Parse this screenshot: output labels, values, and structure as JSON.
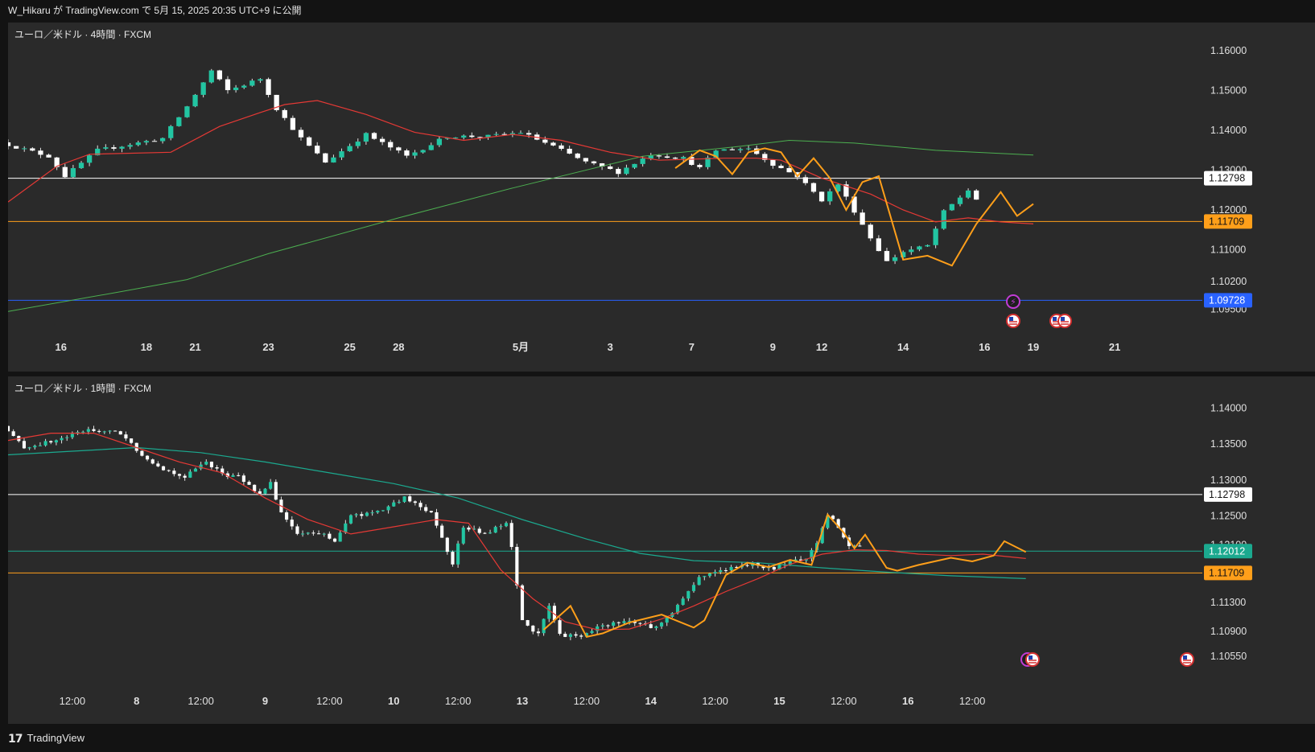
{
  "header": {
    "published": "W_Hikaru が TradingView.com で 5月 15, 2025 20:35 UTC+9 に公開"
  },
  "footer": {
    "brand": "TradingView",
    "logo_icon": "tradingview-logo-icon"
  },
  "colors": {
    "bg": "#2a2a2a",
    "up": "#22c5a2",
    "down": "#ffffff",
    "wick": "#e0e0e0",
    "ma_red": "#e53935",
    "ma_green": "#4caf50",
    "ma_teal": "#1ba98f",
    "zigzag": "#ff9f1a",
    "orange_line": "#ff9f1a",
    "white_line": "#ffffff",
    "blue_line": "#2962ff"
  },
  "chart_data": [
    {
      "type": "candlestick",
      "title": "ユーロ／米ドル · 4時間 · FXCM",
      "symbol": "EURUSD",
      "timeframe": "4時間",
      "source": "FXCM",
      "ylim": [
        1.0915,
        1.1655
      ],
      "y_ticks": [
        "1.16000",
        "1.15000",
        "1.14000",
        "1.13000",
        "1.12000",
        "1.11000",
        "1.10200",
        "1.09500"
      ],
      "x_ticks": [
        "16",
        "18",
        "21",
        "23",
        "25",
        "28",
        "5月",
        "3",
        "7",
        "9",
        "12",
        "14",
        "16",
        "19",
        "21"
      ],
      "x_tick_index": [
        6.5,
        17,
        23,
        32,
        42,
        48,
        63,
        74,
        84,
        94,
        100,
        110,
        120,
        126,
        136
      ],
      "bar_count": 120,
      "anchors": [
        [
          0,
          1.137
        ],
        [
          6,
          1.1335
        ],
        [
          8,
          1.1285
        ],
        [
          12,
          1.135
        ],
        [
          20,
          1.138
        ],
        [
          23,
          1.146
        ],
        [
          26,
          1.155
        ],
        [
          28,
          1.15
        ],
        [
          32,
          1.153
        ],
        [
          34,
          1.1455
        ],
        [
          37,
          1.138
        ],
        [
          40,
          1.132
        ],
        [
          45,
          1.139
        ],
        [
          50,
          1.1335
        ],
        [
          55,
          1.1385
        ],
        [
          60,
          1.1385
        ],
        [
          64,
          1.1395
        ],
        [
          68,
          1.136
        ],
        [
          72,
          1.132
        ],
        [
          76,
          1.1295
        ],
        [
          80,
          1.134
        ],
        [
          84,
          1.133
        ],
        [
          86,
          1.1305
        ],
        [
          88,
          1.135
        ],
        [
          92,
          1.1355
        ],
        [
          95,
          1.1315
        ],
        [
          98,
          1.1285
        ],
        [
          101,
          1.1225
        ],
        [
          103,
          1.1265
        ],
        [
          107,
          1.113
        ],
        [
          109,
          1.107
        ],
        [
          111,
          1.1095
        ],
        [
          114,
          1.111
        ],
        [
          116,
          1.1195
        ],
        [
          119,
          1.125
        ],
        [
          122,
          1.118
        ],
        [
          126,
          1.1205
        ]
      ],
      "levels": [
        {
          "value": 1.12798,
          "label": "1.12798",
          "color": "#ffffff",
          "text": "#131313"
        },
        {
          "value": 1.11709,
          "label": "1.11709",
          "color": "#ff9f1a",
          "text": "#131313"
        },
        {
          "value": 1.09728,
          "label": "1.09728",
          "color": "#2962ff",
          "text": "#ffffff"
        }
      ],
      "ma_red": [
        [
          0,
          1.122
        ],
        [
          6,
          1.131
        ],
        [
          10,
          1.134
        ],
        [
          20,
          1.1345
        ],
        [
          26,
          1.141
        ],
        [
          31,
          1.1445
        ],
        [
          34,
          1.1465
        ],
        [
          38,
          1.1475
        ],
        [
          44,
          1.144
        ],
        [
          50,
          1.1395
        ],
        [
          56,
          1.1375
        ],
        [
          62,
          1.139
        ],
        [
          68,
          1.1375
        ],
        [
          74,
          1.1345
        ],
        [
          80,
          1.1325
        ],
        [
          88,
          1.133
        ],
        [
          92,
          1.133
        ],
        [
          95,
          1.1325
        ],
        [
          100,
          1.128
        ],
        [
          106,
          1.124
        ],
        [
          110,
          1.12
        ],
        [
          114,
          1.117
        ],
        [
          118,
          1.118
        ],
        [
          122,
          1.117
        ],
        [
          126,
          1.1165
        ]
      ],
      "ma_green": [
        [
          0,
          1.0945
        ],
        [
          14,
          1.0995
        ],
        [
          22,
          1.1025
        ],
        [
          32,
          1.109
        ],
        [
          48,
          1.118
        ],
        [
          62,
          1.1255
        ],
        [
          78,
          1.1335
        ],
        [
          90,
          1.136
        ],
        [
          96,
          1.1375
        ],
        [
          104,
          1.1368
        ],
        [
          114,
          1.135
        ],
        [
          126,
          1.1338
        ]
      ],
      "zigzag": [
        [
          82,
          1.1305
        ],
        [
          85,
          1.135
        ],
        [
          87,
          1.1335
        ],
        [
          89,
          1.129
        ],
        [
          91,
          1.1345
        ],
        [
          93,
          1.1355
        ],
        [
          95,
          1.1345
        ],
        [
          97,
          1.1285
        ],
        [
          99,
          1.133
        ],
        [
          101,
          1.128
        ],
        [
          103,
          1.12
        ],
        [
          105,
          1.127
        ],
        [
          107,
          1.1285
        ],
        [
          110,
          1.1075
        ],
        [
          113,
          1.1085
        ],
        [
          116,
          1.106
        ],
        [
          119,
          1.1165
        ],
        [
          122,
          1.1245
        ],
        [
          124,
          1.1185
        ],
        [
          126,
          1.1215
        ]
      ],
      "events": [
        "lightning-icon",
        "us-flag-icon",
        "us-flag-icon",
        "us-flag-icon"
      ]
    },
    {
      "type": "candlestick",
      "title": "ユーロ／米ドル · 1時間 · FXCM",
      "symbol": "EURUSD",
      "timeframe": "1時間",
      "source": "FXCM",
      "ylim": [
        1.1035,
        1.1435
      ],
      "y_ticks": [
        "1.14000",
        "1.13500",
        "1.13000",
        "1.12500",
        "1.12100",
        "1.11300",
        "1.10900",
        "1.10550"
      ],
      "x_ticks": [
        "12:00",
        "8",
        "12:00",
        "9",
        "12:00",
        "10",
        "12:00",
        "13",
        "12:00",
        "14",
        "12:00",
        "15",
        "12:00",
        "16",
        "12:00"
      ],
      "x_tick_index": [
        12,
        24,
        36,
        48,
        60,
        72,
        84,
        96,
        108,
        120,
        132,
        144,
        156,
        168,
        180
      ],
      "bar_count": 160,
      "anchors": [
        [
          0,
          1.1375
        ],
        [
          4,
          1.1345
        ],
        [
          10,
          1.1355
        ],
        [
          16,
          1.137
        ],
        [
          22,
          1.1365
        ],
        [
          26,
          1.1335
        ],
        [
          30,
          1.1315
        ],
        [
          34,
          1.1305
        ],
        [
          38,
          1.1325
        ],
        [
          42,
          1.1305
        ],
        [
          44,
          1.1305
        ],
        [
          48,
          1.128
        ],
        [
          50,
          1.1295
        ],
        [
          52,
          1.1255
        ],
        [
          55,
          1.1225
        ],
        [
          60,
          1.1225
        ],
        [
          62,
          1.1215
        ],
        [
          65,
          1.125
        ],
        [
          70,
          1.1255
        ],
        [
          75,
          1.1275
        ],
        [
          80,
          1.1255
        ],
        [
          84,
          1.1185
        ],
        [
          86,
          1.1235
        ],
        [
          90,
          1.1225
        ],
        [
          94,
          1.124
        ],
        [
          95,
          1.1205
        ],
        [
          97,
          1.1105
        ],
        [
          100,
          1.1085
        ],
        [
          102,
          1.1125
        ],
        [
          104,
          1.1085
        ],
        [
          108,
          1.1082
        ],
        [
          111,
          1.1095
        ],
        [
          116,
          1.1105
        ],
        [
          122,
          1.1095
        ],
        [
          126,
          1.1125
        ],
        [
          130,
          1.1165
        ],
        [
          134,
          1.1175
        ],
        [
          140,
          1.1183
        ],
        [
          144,
          1.1177
        ],
        [
          150,
          1.1193
        ],
        [
          152,
          1.121
        ],
        [
          154,
          1.1252
        ],
        [
          156,
          1.1235
        ],
        [
          158,
          1.121
        ],
        [
          162,
          1.1205
        ],
        [
          164,
          1.1186
        ],
        [
          168,
          1.117
        ],
        [
          172,
          1.1185
        ],
        [
          176,
          1.1191
        ],
        [
          180,
          1.1193
        ],
        [
          184,
          1.12
        ],
        [
          186,
          1.1215
        ],
        [
          188,
          1.121
        ],
        [
          190,
          1.1201
        ]
      ],
      "levels": [
        {
          "value": 1.12798,
          "label": "1.12798",
          "color": "#ffffff",
          "text": "#131313"
        },
        {
          "value": 1.12012,
          "label": "1.12012",
          "color": "#1ba98f",
          "text": "#ffffff"
        },
        {
          "value": 1.11709,
          "label": "1.11709",
          "color": "#ff9f1a",
          "text": "#131313"
        }
      ],
      "ma_red": [
        [
          0,
          1.1355
        ],
        [
          8,
          1.1365
        ],
        [
          16,
          1.1365
        ],
        [
          24,
          1.1345
        ],
        [
          32,
          1.1325
        ],
        [
          40,
          1.131
        ],
        [
          48,
          1.1275
        ],
        [
          56,
          1.1245
        ],
        [
          64,
          1.1225
        ],
        [
          72,
          1.1235
        ],
        [
          80,
          1.1245
        ],
        [
          86,
          1.124
        ],
        [
          92,
          1.1175
        ],
        [
          98,
          1.1135
        ],
        [
          104,
          1.1103
        ],
        [
          110,
          1.1092
        ],
        [
          116,
          1.1093
        ],
        [
          122,
          1.1107
        ],
        [
          128,
          1.1125
        ],
        [
          134,
          1.1145
        ],
        [
          140,
          1.1163
        ],
        [
          146,
          1.1183
        ],
        [
          152,
          1.1197
        ],
        [
          158,
          1.1203
        ],
        [
          164,
          1.1202
        ],
        [
          170,
          1.1197
        ],
        [
          176,
          1.1195
        ],
        [
          182,
          1.1197
        ],
        [
          190,
          1.1191
        ]
      ],
      "ma_teal": [
        [
          0,
          1.1335
        ],
        [
          12,
          1.134
        ],
        [
          24,
          1.1345
        ],
        [
          36,
          1.1338
        ],
        [
          48,
          1.1325
        ],
        [
          60,
          1.131
        ],
        [
          72,
          1.1295
        ],
        [
          84,
          1.1275
        ],
        [
          96,
          1.1245
        ],
        [
          108,
          1.1218
        ],
        [
          118,
          1.1198
        ],
        [
          128,
          1.1188
        ],
        [
          140,
          1.1185
        ],
        [
          152,
          1.1178
        ],
        [
          164,
          1.1172
        ],
        [
          176,
          1.1167
        ],
        [
          190,
          1.1163
        ]
      ],
      "zigzag": [
        [
          100,
          1.1092
        ],
        [
          105,
          1.1125
        ],
        [
          108,
          1.1082
        ],
        [
          111,
          1.1087
        ],
        [
          116,
          1.1102
        ],
        [
          122,
          1.1113
        ],
        [
          128,
          1.1095
        ],
        [
          130,
          1.1105
        ],
        [
          134,
          1.1168
        ],
        [
          138,
          1.1185
        ],
        [
          142,
          1.1179
        ],
        [
          146,
          1.1189
        ],
        [
          150,
          1.1182
        ],
        [
          153,
          1.1252
        ],
        [
          156,
          1.1227
        ],
        [
          158,
          1.1205
        ],
        [
          160,
          1.1224
        ],
        [
          164,
          1.1178
        ],
        [
          166,
          1.1174
        ],
        [
          170,
          1.1182
        ],
        [
          176,
          1.1192
        ],
        [
          180,
          1.1187
        ],
        [
          184,
          1.1195
        ],
        [
          186,
          1.1215
        ],
        [
          190,
          1.12
        ]
      ],
      "events": [
        "lightning-icon",
        "us-flag-icon",
        "us-flag-icon"
      ]
    }
  ]
}
